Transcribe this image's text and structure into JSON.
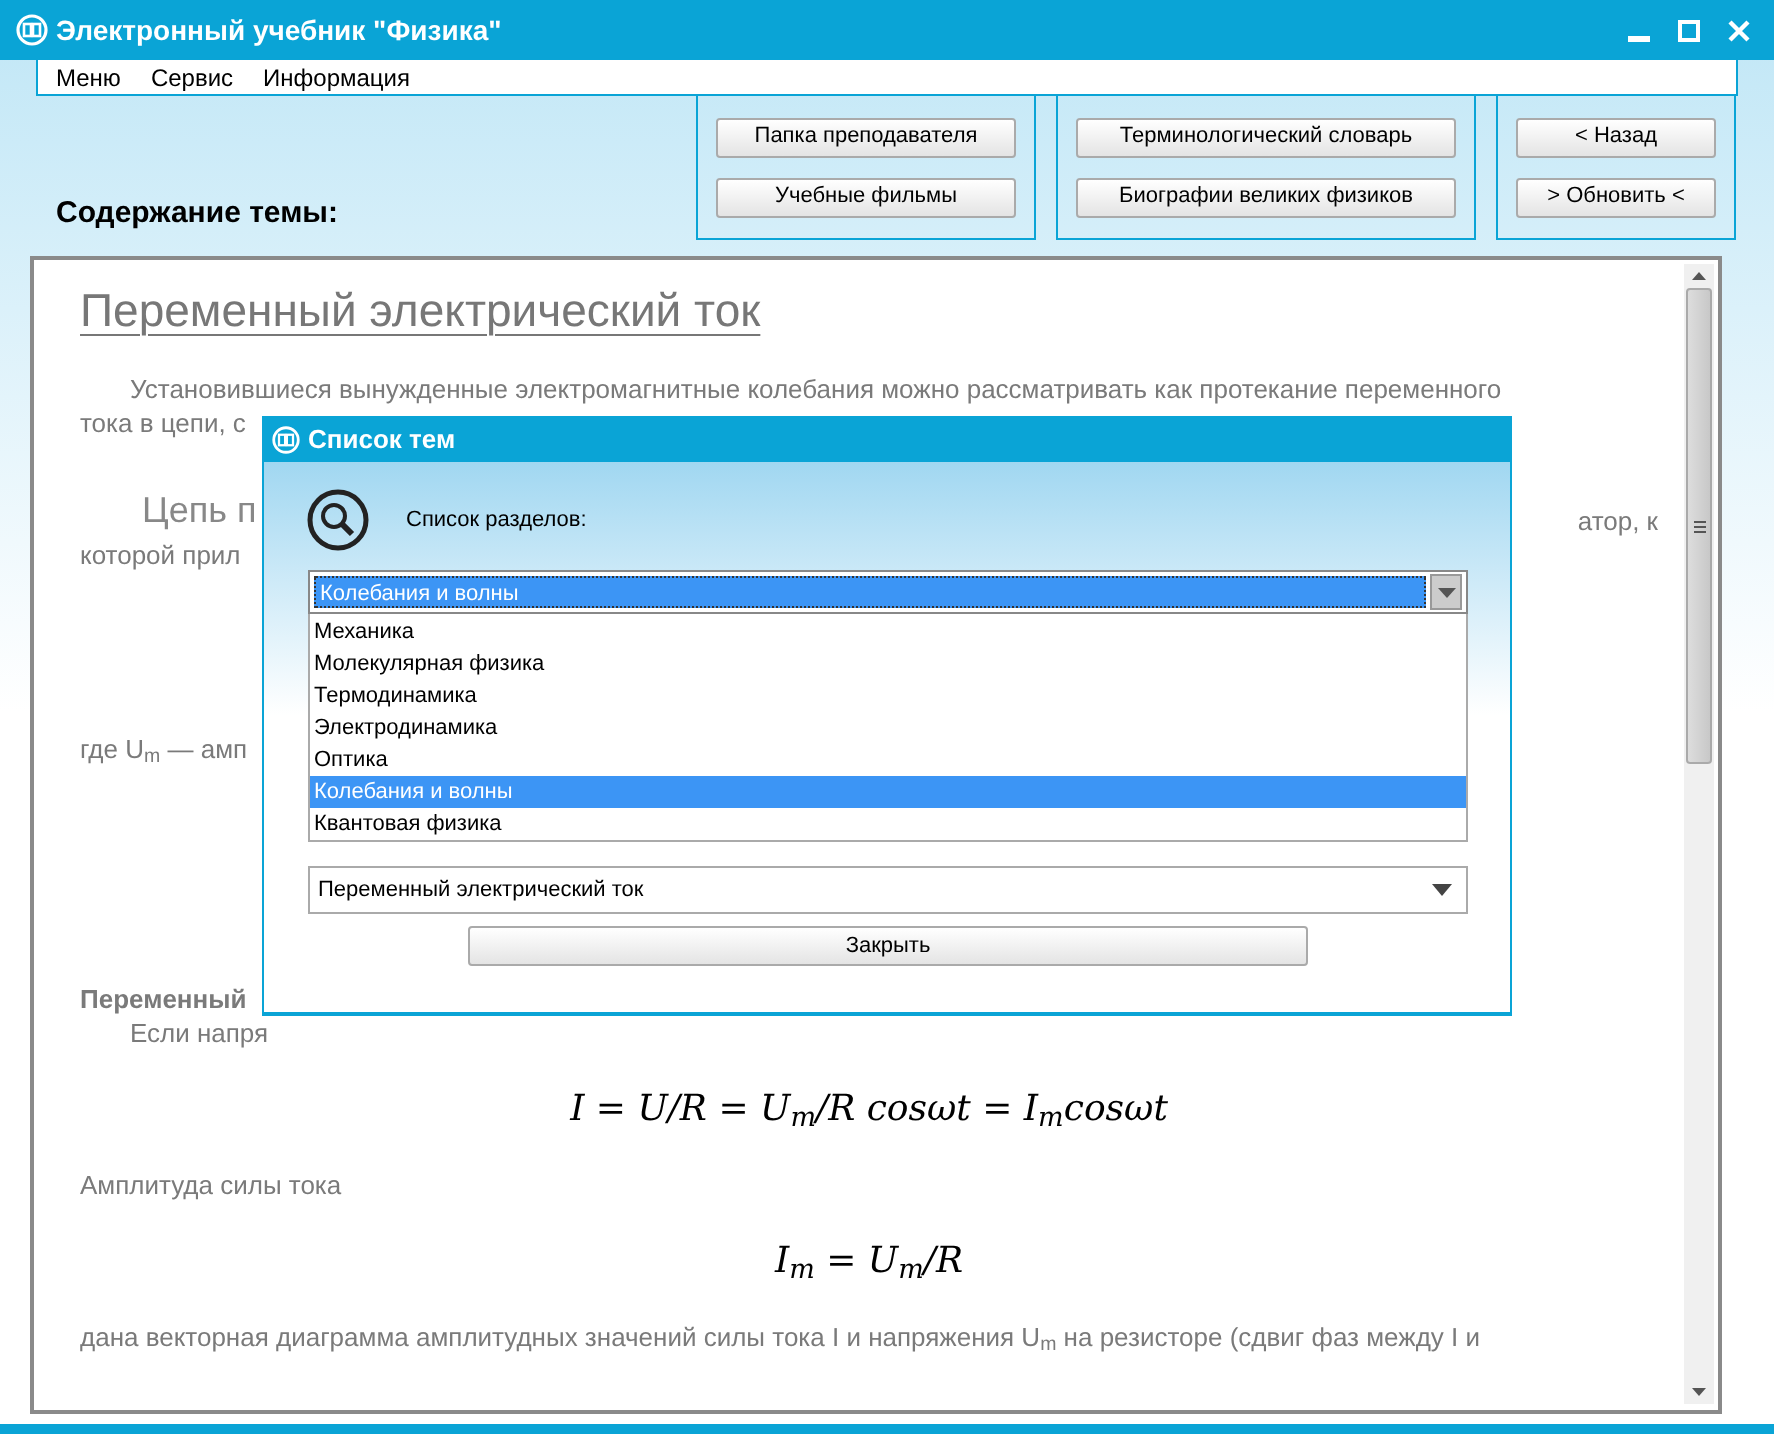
{
  "window": {
    "title": "Электронный учебник \"Физика\""
  },
  "menu": [
    {
      "label": "Меню"
    },
    {
      "label": "Сервис"
    },
    {
      "label": "Информация"
    }
  ],
  "button_groups": [
    [
      "Папка преподавателя",
      "Учебные фильмы"
    ],
    [
      "Терминологический словарь",
      "Биографии великих физиков"
    ],
    [
      "< Назад",
      "> Обновить <"
    ]
  ],
  "section_label": "Содержание темы:",
  "content": [
    {
      "kind": "title",
      "text": "Переменный электрический ток"
    },
    {
      "kind": "para",
      "text": "Установившиеся вынужденные электромагнитные колебания можно рассматривать как протекание переменного"
    },
    {
      "kind": "line",
      "text": "тока в цепи, с"
    },
    {
      "kind": "split",
      "text": "Цепь п",
      "right": "атор, к"
    },
    {
      "kind": "line",
      "text": "которой прил"
    },
    {
      "kind": "gap"
    },
    {
      "kind": "line",
      "text": "где U$_{m}$ — амп"
    },
    {
      "kind": "gap"
    },
    {
      "kind": "bold",
      "text": "Переменный"
    },
    {
      "kind": "para",
      "text": "Если напря"
    },
    {
      "kind": "formula",
      "text": "I = U/R = U$_{m}$/R cosωt = I$_{m}$cosωt"
    },
    {
      "kind": "line",
      "text": "Амплитуда силы тока"
    },
    {
      "kind": "formula",
      "text": "I$_{m}$ = U$_{m}$/R"
    },
    {
      "kind": "line",
      "text": "дана векторная диаграмма амплитудных значений силы тока I и напряжения U$_{m}$ на резисторе (сдвиг фаз между I и"
    }
  ],
  "dialog": {
    "title": "Список тем",
    "sections_label": "Список разделов:",
    "section_value": "Колебания и волны",
    "sections": [
      {
        "label": "Механика",
        "selected": false
      },
      {
        "label": "Молекулярная физика",
        "selected": false
      },
      {
        "label": "Термодинамика",
        "selected": false
      },
      {
        "label": "Электродинамика",
        "selected": false
      },
      {
        "label": "Оптика",
        "selected": false
      },
      {
        "label": "Колебания и волны",
        "selected": true
      },
      {
        "label": "Квантовая физика",
        "selected": false
      }
    ],
    "topic_value": "Переменный электрический ток",
    "close_button": "Закрыть"
  }
}
